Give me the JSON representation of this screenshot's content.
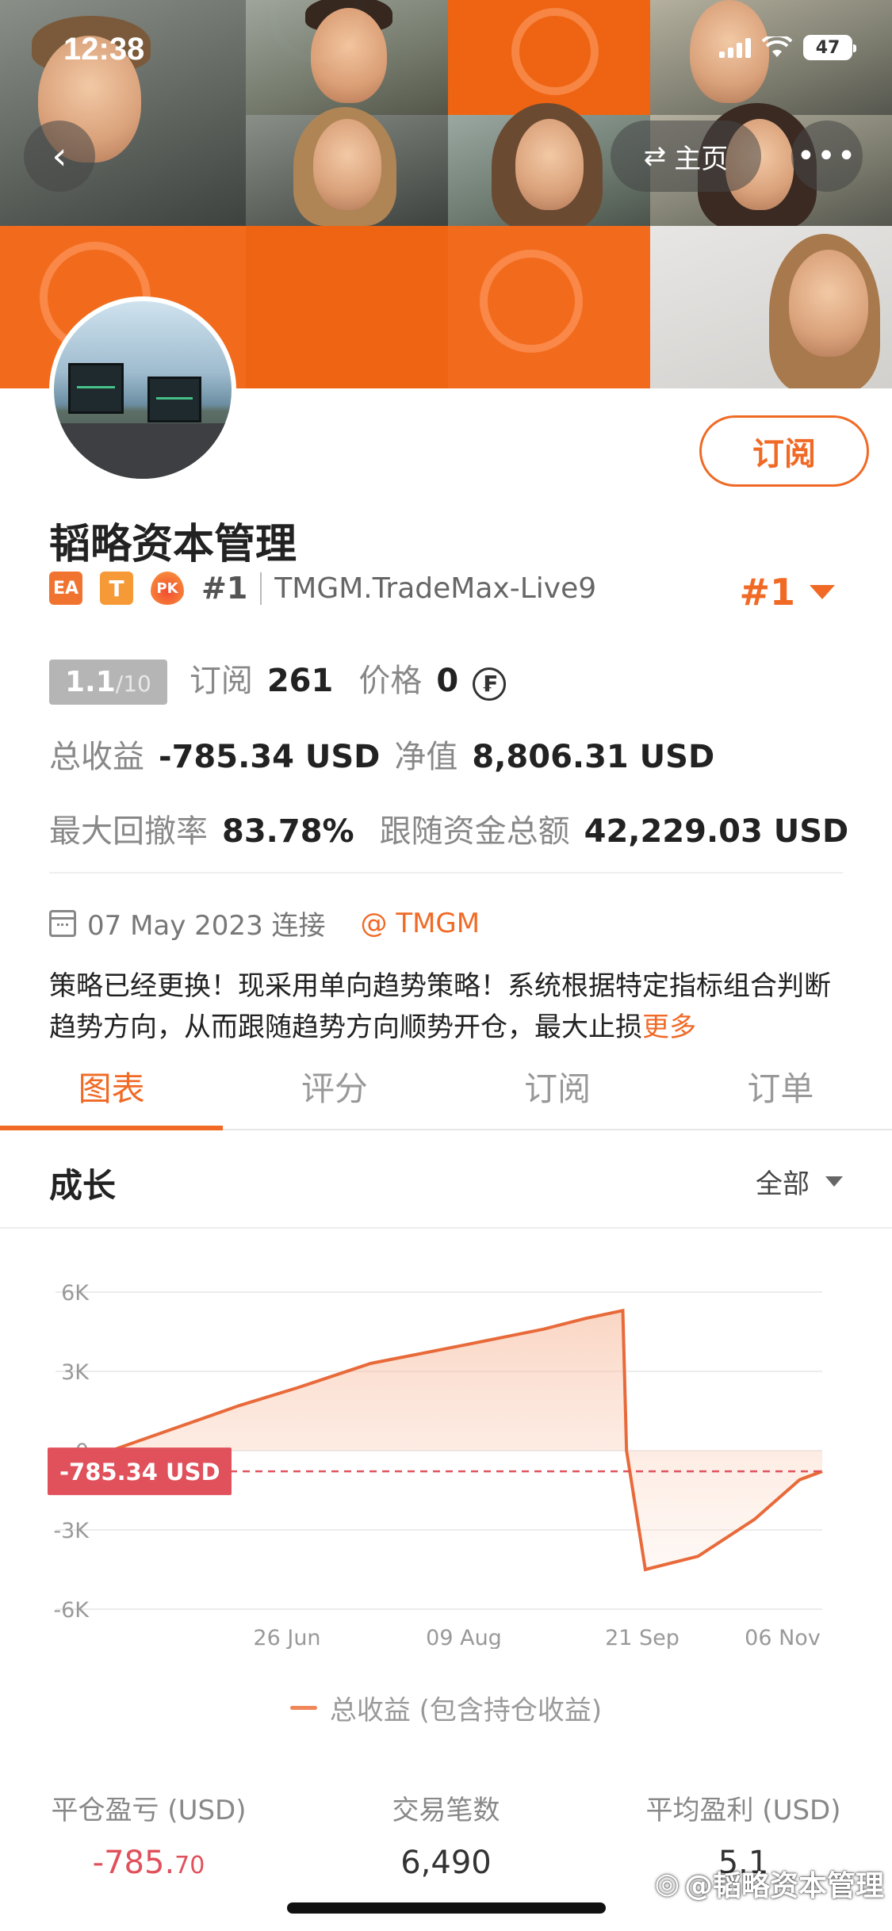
{
  "status_bar": {
    "time": "12:38",
    "battery": "47"
  },
  "nav": {
    "home_label": "主页",
    "more_glyph": "•••"
  },
  "profile": {
    "name": "韬略资本管理",
    "subscribe_label": "订阅",
    "badges": [
      "EA",
      "T",
      "PK"
    ],
    "rank_small": "#1",
    "broker": "TMGM.TradeMax-Live9",
    "rank_big": "#1",
    "score": "1.1",
    "score_max": "/10",
    "subscribe_count_label": "订阅",
    "subscribe_count": "261",
    "price_label": "价格",
    "price": "0",
    "total_profit_label": "总收益",
    "total_profit": "-785.34 USD",
    "equity_label": "净值",
    "equity": "8,806.31 USD",
    "max_drawdown_label": "最大回撤率",
    "max_drawdown": "83.78%",
    "follow_funds_label": "跟随资金总额",
    "follow_funds": "42,229.03 USD",
    "connected_date": "07 May 2023 连接",
    "connected_broker": "@ TMGM",
    "description": "策略已经更换！现采用单向趋势策略！系统根据特定指标组合判断趋势方向，从而跟随趋势方向顺势开仓，最大止损",
    "more_label": "更多"
  },
  "tabs": [
    "图表",
    "评分",
    "订阅",
    "订单"
  ],
  "section": {
    "title": "成长",
    "filter": "全部"
  },
  "chart_data": {
    "type": "area",
    "yticks": [
      "6K",
      "3K",
      "0",
      "-3K",
      "-6K"
    ],
    "ylim": [
      -6000,
      6000
    ],
    "xticks": [
      "26 Jun",
      "09 Aug",
      "21 Sep",
      "06 Nov"
    ],
    "series": [
      {
        "name": "总收益 (包含持仓收益)",
        "x": [
          "2023-05-07",
          "2023-05-25",
          "2023-06-10",
          "2023-06-26",
          "2023-07-15",
          "2023-08-09",
          "2023-08-30",
          "2023-09-10",
          "2023-09-20",
          "2023-09-21",
          "2023-09-26",
          "2023-10-10",
          "2023-10-25",
          "2023-11-06",
          "2023-11-12"
        ],
        "values": [
          0,
          900,
          1700,
          2400,
          3300,
          4000,
          4600,
          5000,
          5300,
          0,
          -4500,
          -4000,
          -2600,
          -1100,
          -785.34
        ]
      }
    ],
    "current_label": "-785.34 USD",
    "current_value": -785.34,
    "color": "#e86a3a"
  },
  "legend_label": "总收益 (包含持仓收益)",
  "bottom_stats": [
    {
      "label": "平仓盈亏 (USD)",
      "value_main": "-785.",
      "value_dec": "70"
    },
    {
      "label": "交易笔数",
      "value_main": "6,490",
      "value_dec": ""
    },
    {
      "label": "平均盈利 (USD)",
      "value_main": "5.1",
      "value_dec": ""
    }
  ],
  "watermark": "@韬略资本管理",
  "colors": {
    "accent": "#f06a26",
    "negative": "#e0515c",
    "chart_line": "#e86a3a"
  }
}
